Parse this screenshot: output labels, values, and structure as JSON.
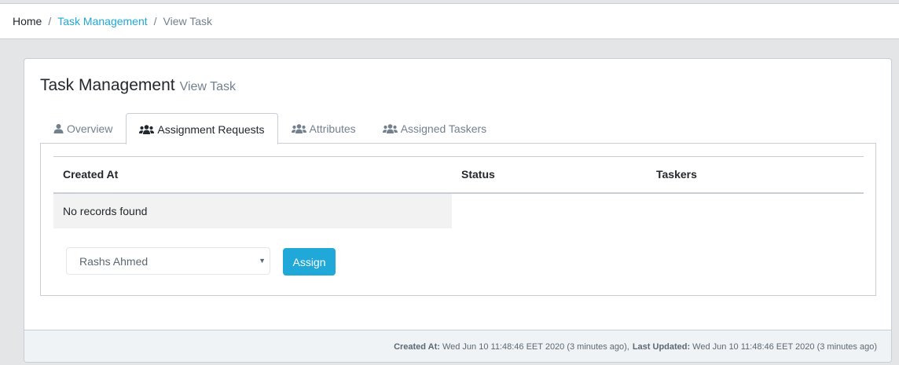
{
  "breadcrumb": {
    "home": "Home",
    "task_management": "Task Management",
    "view_task": "View Task",
    "separator": "/"
  },
  "card": {
    "title": "Task Management",
    "subtitle": "View Task"
  },
  "tabs": [
    {
      "label": "Overview",
      "icon": "user-icon",
      "active": false
    },
    {
      "label": "Assignment Requests",
      "icon": "users-icon",
      "active": true
    },
    {
      "label": "Attributes",
      "icon": "users-icon",
      "active": false
    },
    {
      "label": "Assigned Taskers",
      "icon": "users-icon",
      "active": false
    }
  ],
  "table": {
    "columns": [
      "Created At",
      "Status",
      "Taskers"
    ],
    "empty_message": "No records found"
  },
  "assign": {
    "selected_tasker": "Rashs Ahmed",
    "button_label": "Assign"
  },
  "footer": {
    "created_label": "Created At:",
    "created_value": "Wed Jun 10 11:48:46 EET 2020 (3 minutes ago),",
    "updated_label": "Last Updated:",
    "updated_value": "Wed Jun 10 11:48:46 EET 2020 (3 minutes ago)"
  },
  "colors": {
    "accent": "#20a8d8",
    "background": "#e4e5e6",
    "border": "#c8ced3"
  }
}
